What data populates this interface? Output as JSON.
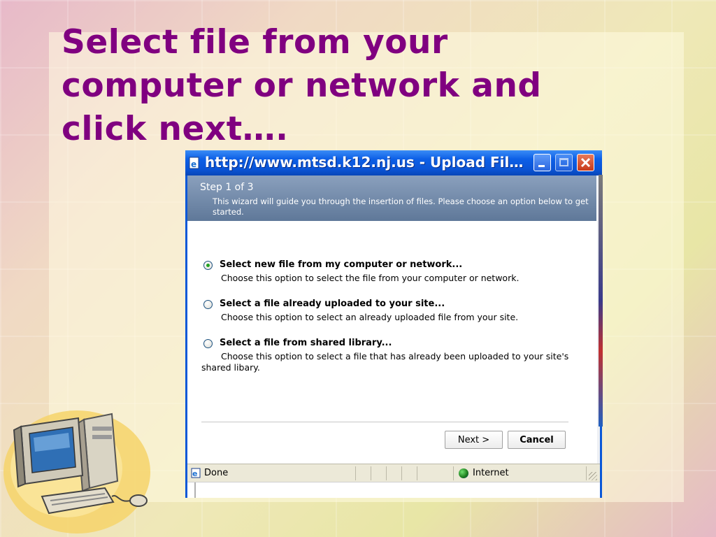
{
  "slide": {
    "title": "Select file from your computer or network and click next…."
  },
  "window": {
    "title": "http://www.mtsd.k12.nj.us - Upload Fil…",
    "icons": {
      "app": "ie-page-icon",
      "minimize": "minimize-icon",
      "maximize": "maximize-icon",
      "close": "close-icon"
    }
  },
  "wizard": {
    "step_title": "Step 1 of 3",
    "description": "This wizard will guide you through the insertion of files. Please choose an option below to get started.",
    "options": [
      {
        "label": "Select new file from my computer or network...",
        "description": "Choose this option to select the file from your computer or network.",
        "selected": true
      },
      {
        "label": "Select a file already uploaded to your site...",
        "description": "Choose this option to select an already uploaded file from your site.",
        "selected": false
      },
      {
        "label": "Select a file from shared library...",
        "description": "Choose this option to select a file that has already been uploaded to your site's shared libary.",
        "selected": false
      }
    ],
    "buttons": {
      "next": "Next >",
      "cancel": "Cancel"
    }
  },
  "statusbar": {
    "status": "Done",
    "zone": "Internet"
  },
  "colors": {
    "title_purple": "#800080",
    "xp_blue": "#0a58d8",
    "header_band": "#6f87a8"
  }
}
